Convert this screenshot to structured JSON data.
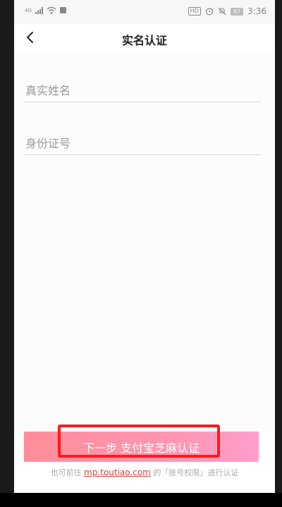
{
  "status_bar": {
    "network": "4G",
    "hd_badge": "HD",
    "battery": "97",
    "time": "3:36",
    "icons": [
      "signal-icon",
      "wifi-icon",
      "notification-icon",
      "hd-icon",
      "alarm-icon",
      "mute-icon",
      "battery-icon"
    ]
  },
  "header": {
    "title": "实名认证",
    "back_icon": "chevron-left-icon"
  },
  "form": {
    "name_placeholder": "真实姓名",
    "name_value": "",
    "id_placeholder": "身份证号",
    "id_value": ""
  },
  "submit": {
    "label": "下一步 支付宝芝麻认证",
    "gradient_start": "#ff8e9a",
    "gradient_end": "#ff9ecd",
    "highlight_color": "#ff1a1a"
  },
  "footer": {
    "prefix": "也可前往",
    "link": "mp.toutiao.com",
    "suffix": "的「账号权限」进行认证",
    "link_color": "#e0403a"
  }
}
